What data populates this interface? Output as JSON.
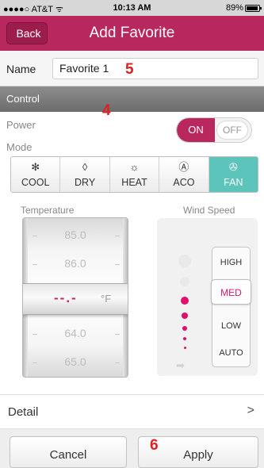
{
  "status_bar": {
    "carrier": "●●●●○ AT&T ᯤ",
    "time": "10:13 AM",
    "battery": "89%"
  },
  "navbar": {
    "back_label": "Back",
    "title": "Add Favorite"
  },
  "name_row": {
    "label": "Name",
    "value": "Favorite 1"
  },
  "control_section": {
    "title": "Control"
  },
  "power": {
    "label": "Power",
    "on_label": "ON",
    "off_label": "OFF",
    "state": "ON"
  },
  "mode": {
    "label": "Mode",
    "items": [
      {
        "label": "COOL",
        "icon": "snowflake-icon",
        "glyph": "✻"
      },
      {
        "label": "DRY",
        "icon": "droplet-icon",
        "glyph": "◊"
      },
      {
        "label": "HEAT",
        "icon": "sun-icon",
        "glyph": "☼"
      },
      {
        "label": "ACO",
        "icon": "auto-mode-icon",
        "glyph": "Ⓐ"
      },
      {
        "label": "FAN",
        "icon": "fan-icon",
        "glyph": "✇"
      }
    ],
    "selected": "FAN",
    "active_color": "#5cc4ba"
  },
  "temperature": {
    "label": "Temperature",
    "values_above": [
      "85.0",
      "86.0"
    ],
    "current": "--.-",
    "unit": "°F",
    "values_below": [
      "64.0",
      "65.0"
    ]
  },
  "wind_speed": {
    "label": "Wind Speed",
    "options": [
      "HIGH",
      "MED",
      "LOW",
      "AUTO"
    ],
    "selected": "MED",
    "wind_arrow_glyph": "➡"
  },
  "detail": {
    "label": "Detail",
    "chevron": ">"
  },
  "buttons": {
    "cancel": "Cancel",
    "apply": "Apply"
  },
  "annotations": {
    "a4": "4",
    "a5": "5",
    "a6": "6"
  },
  "colors": {
    "brand": "#b8285e",
    "accent": "#e0106a",
    "annotation": "#e02020"
  }
}
